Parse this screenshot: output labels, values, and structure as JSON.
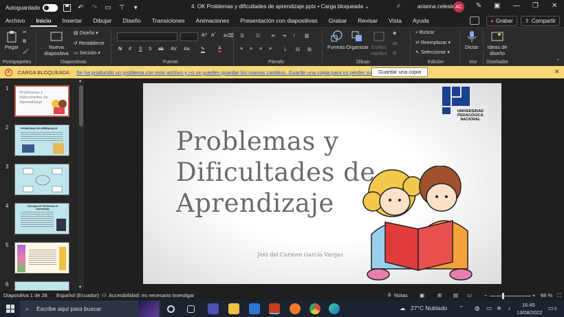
{
  "titlebar": {
    "autosave_label": "Autoguardado",
    "doc_title": "4. OK Problemas y dificultades de aprendizaje.pptx • Carga bloqueada ⌄",
    "user_name": "arianna celeste",
    "user_initials": "AC"
  },
  "tabs": [
    "Archivo",
    "Inicio",
    "Insertar",
    "Dibujar",
    "Diseño",
    "Transiciones",
    "Animaciones",
    "Presentación con diapositivas",
    "Grabar",
    "Revisar",
    "Vista",
    "Ayuda"
  ],
  "active_tab": "Inicio",
  "header_buttons": {
    "record": "Grabar",
    "share": "Compartir"
  },
  "ribbon": {
    "groups": {
      "clipboard": "Portapapeles",
      "slides": "Diapositivas",
      "font": "Fuente",
      "paragraph": "Párrafo",
      "drawing": "Dibujo",
      "editing": "Edición",
      "voice": "Voz",
      "designer": "Diseñador"
    },
    "paste": "Pegar",
    "new_slide": "Nueva diapositiva",
    "layout": "Diseño",
    "reset": "Restablecer",
    "section": "Sección",
    "shapes": "Formas",
    "arrange": "Organizar",
    "quick_styles": "Estilos rápidos",
    "find": "Buscar",
    "replace": "Reemplazar",
    "select": "Seleccionar",
    "dictate": "Dictar",
    "design_ideas": "Ideas de diseño",
    "font_buttons": [
      "N",
      "K",
      "S",
      "S",
      "ab",
      "AV",
      "Aa",
      "A"
    ]
  },
  "notification": {
    "title": "CARGA BLOQUEADA",
    "message": "Se ha producido un problema con este archivo y no se pueden guardar los nuevos cambios. Guarde una copia para no perder su trabajo.",
    "button": "Guardar una copia"
  },
  "thumbnails": [
    {
      "num": "1",
      "text": "Problemas y Dificultades de Aprendizaje"
    },
    {
      "num": "2",
      "text": "PROBLEMAS DE APRENDIZAJE"
    },
    {
      "num": "3",
      "text": ""
    },
    {
      "num": "4",
      "text": "Concepto de Problemas de Aprendizaje"
    },
    {
      "num": "5",
      "text": ""
    },
    {
      "num": "6",
      "text": ""
    }
  ],
  "slide": {
    "title_lines": [
      "Problemas y",
      "Dificultades de",
      "Aprendizaje"
    ],
    "author": "Jeni del Carmen García Vargas",
    "logo_text": [
      "UNIVERSIDAD",
      "PEDAGÓGICA",
      "NACIONAL"
    ]
  },
  "statusbar": {
    "slide_count": "Diapositiva 1 de 28",
    "language": "Español (Ecuador)",
    "accessibility": "Accesibilidad: es necesario investigar",
    "notes": "Notas",
    "zoom": "68 %"
  },
  "taskbar": {
    "search_placeholder": "Escribe aquí para buscar",
    "weather": "27°C  Nublado",
    "time": "16:45",
    "date": "13/08/2022",
    "notification_count": "3"
  },
  "colors": {
    "accent": "#c4314b",
    "notif_bg": "#f7d774",
    "link": "#1a56c7"
  }
}
